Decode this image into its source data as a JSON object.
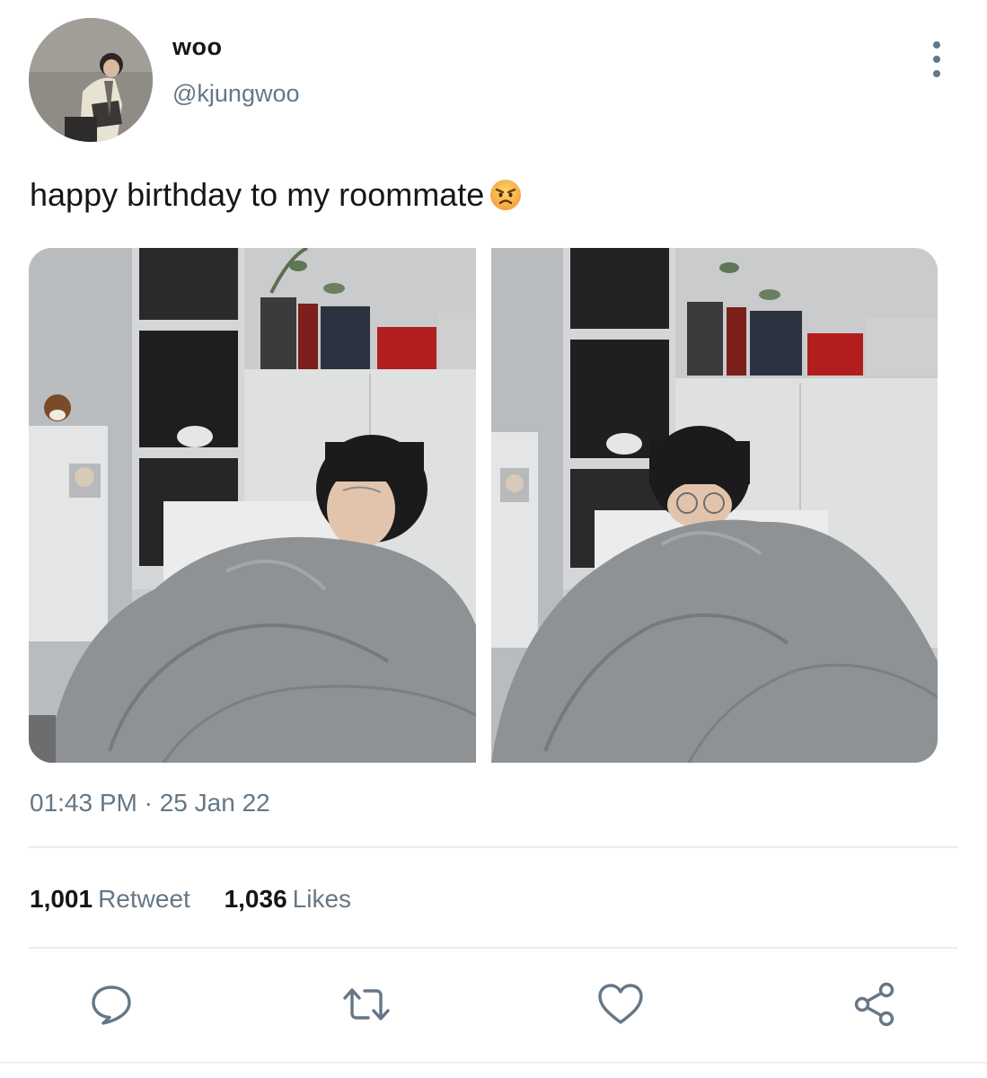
{
  "user": {
    "display_name": "woo",
    "handle": "@kjungwoo",
    "avatar_icon": "profile-avatar"
  },
  "tweet": {
    "text": "happy birthday to my roommate",
    "emoji": "angry-face-emoji",
    "timestamp": "01:43 PM · 25 Jan 22"
  },
  "stats": {
    "retweets_count": "1,001",
    "retweets_label": "Retweet",
    "likes_count": "1,036",
    "likes_label": "Likes"
  },
  "actions": {
    "reply_icon": "speech-bubble-icon",
    "retweet_icon": "retweet-icon",
    "like_icon": "heart-icon",
    "share_icon": "share-icon"
  },
  "colors": {
    "text_primary": "#14171a",
    "text_secondary": "#657786",
    "divider": "#e6ecf0"
  }
}
